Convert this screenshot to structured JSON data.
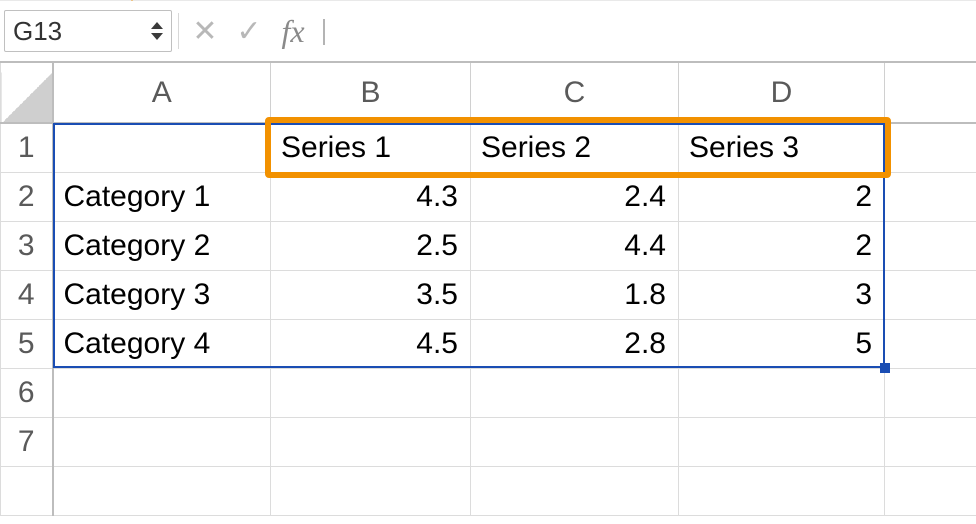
{
  "formula_bar": {
    "name_box": "G13",
    "cancel_tip": "Cancel",
    "accept_tip": "Accept",
    "fx_label": "fx",
    "formula_value": ""
  },
  "column_headers": [
    "A",
    "B",
    "C",
    "D"
  ],
  "row_headers": [
    "1",
    "2",
    "3",
    "4",
    "5",
    "6",
    "7"
  ],
  "series_headers": [
    "Series 1",
    "Series 2",
    "Series 3"
  ],
  "categories": [
    "Category 1",
    "Category 2",
    "Category 3",
    "Category 4"
  ],
  "data": [
    [
      "4.3",
      "2.4",
      "2"
    ],
    [
      "2.5",
      "4.4",
      "2"
    ],
    [
      "3.5",
      "1.8",
      "3"
    ],
    [
      "4.5",
      "2.8",
      "5"
    ]
  ],
  "chart_data": {
    "type": "table",
    "categories": [
      "Category 1",
      "Category 2",
      "Category 3",
      "Category 4"
    ],
    "series": [
      {
        "name": "Series 1",
        "values": [
          4.3,
          2.5,
          3.5,
          4.5
        ]
      },
      {
        "name": "Series 2",
        "values": [
          2.4,
          4.4,
          1.8,
          2.8
        ]
      },
      {
        "name": "Series 3",
        "values": [
          2,
          2,
          3,
          5
        ]
      }
    ]
  }
}
